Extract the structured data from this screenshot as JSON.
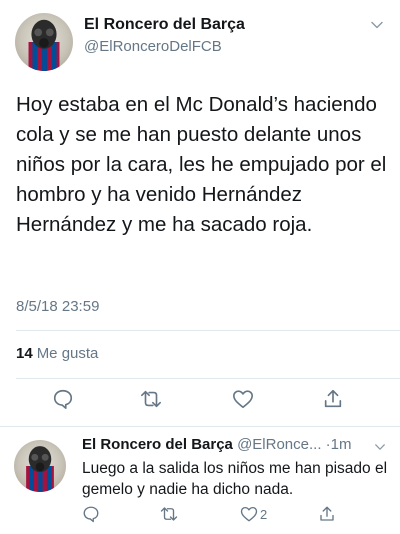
{
  "tweet": {
    "author_name": "El Roncero del Barça",
    "author_handle": "@ElRonceroDelFCB",
    "text": "Hoy estaba en el Mc Donald’s haciendo cola y se me han puesto delante unos niños por la cara, les he empujado por el hombro y ha venido Hernández Hernández y me ha sacado roja.",
    "timestamp": "8/5/18 23:59",
    "likes_count": "14",
    "likes_label": "Me gusta",
    "icons": [
      "avatar",
      "chevron-down-icon",
      "reply-icon",
      "retweet-icon",
      "like-icon",
      "share-icon"
    ]
  },
  "reply": {
    "author_name": "El Roncero del Barça",
    "author_handle": "@ElRonce...",
    "separator": "·",
    "time": "1m",
    "text": "Luego a la salida los niños me han pisado el gemelo y nadie ha dicho nada.",
    "like_count": "2"
  },
  "colors": {
    "text": "#14171a",
    "secondary": "#657786",
    "icon": "#657786",
    "divider": "#e1e8ed"
  }
}
